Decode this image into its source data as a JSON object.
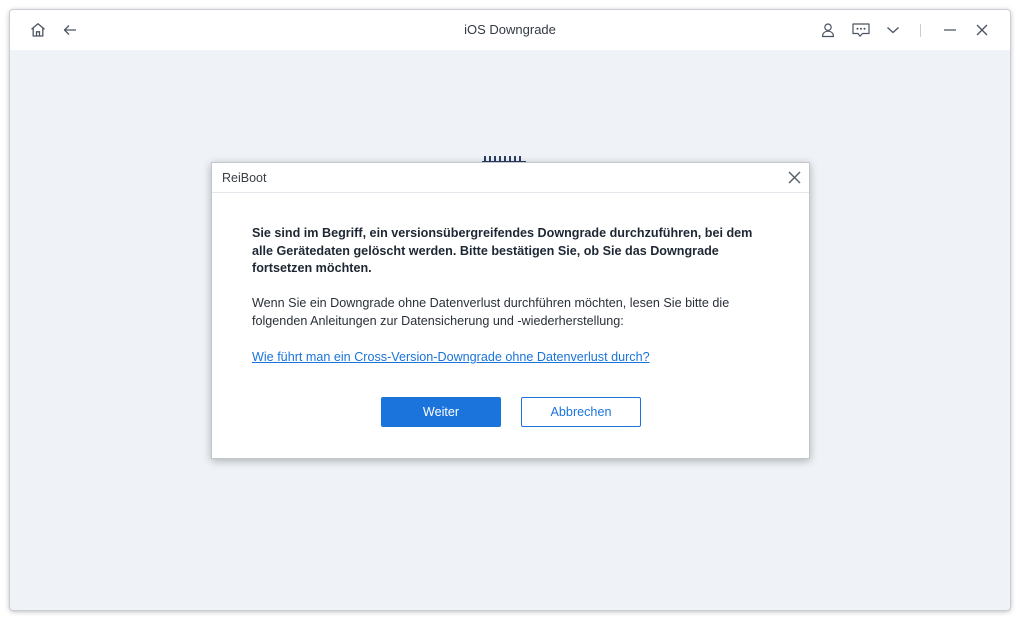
{
  "window": {
    "title": "iOS Downgrade"
  },
  "titlebar": {
    "left_icons": [
      "home-icon",
      "back-arrow-icon"
    ],
    "right_icons": [
      "user-icon",
      "feedback-icon",
      "chevron-down-icon",
      "minimize-icon",
      "close-icon"
    ]
  },
  "dialog": {
    "title": "ReiBoot",
    "warning": "Sie sind im Begriff, ein versionsübergreifendes Downgrade durchzuführen, bei dem alle Gerätedaten gelöscht werden. Bitte bestätigen Sie, ob Sie das Downgrade fortsetzen möchten.",
    "info": "Wenn Sie ein Downgrade ohne Datenverlust durchführen möchten, lesen Sie bitte die folgenden Anleitungen zur Datensicherung und -wiederherstellung:",
    "link": "Wie führt man ein Cross-Version-Downgrade ohne Datenverlust durch?",
    "confirm_label": "Weiter",
    "cancel_label": "Abbrechen"
  },
  "colors": {
    "accent": "#1a74dc",
    "background": "#eff3f7",
    "titlebar": "#ffffff"
  }
}
